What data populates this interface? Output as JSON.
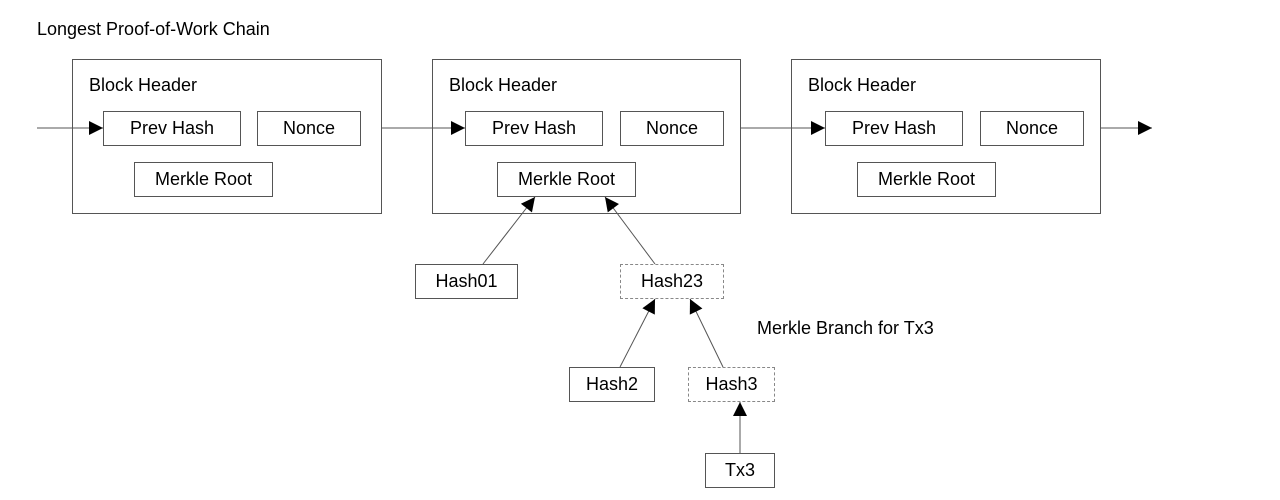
{
  "diagram": {
    "title": "Longest Proof-of-Work Chain",
    "blocks": [
      {
        "label": "Block Header",
        "fields": {
          "prev_hash": "Prev Hash",
          "nonce": "Nonce",
          "merkle_root": "Merkle Root"
        }
      },
      {
        "label": "Block Header",
        "fields": {
          "prev_hash": "Prev Hash",
          "nonce": "Nonce",
          "merkle_root": "Merkle Root"
        }
      },
      {
        "label": "Block Header",
        "fields": {
          "prev_hash": "Prev Hash",
          "nonce": "Nonce",
          "merkle_root": "Merkle Root"
        }
      }
    ],
    "tree": {
      "hash01": "Hash01",
      "hash23": "Hash23",
      "hash2": "Hash2",
      "hash3": "Hash3",
      "tx3": "Tx3"
    },
    "branch_label": "Merkle Branch for Tx3"
  }
}
